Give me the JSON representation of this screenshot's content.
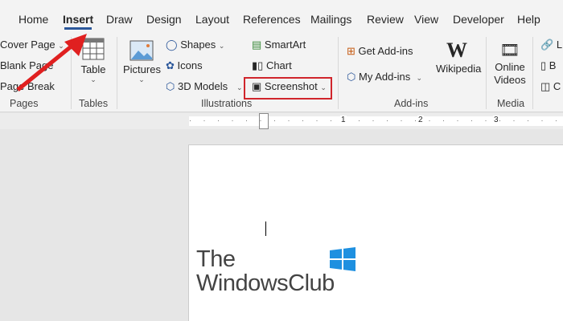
{
  "tabs": [
    "Home",
    "Insert",
    "Draw",
    "Design",
    "Layout",
    "References",
    "Mailings",
    "Review",
    "View",
    "Developer",
    "Help"
  ],
  "active_tab": "Insert",
  "pages": {
    "items": [
      "Cover Page",
      "Blank Page",
      "Page Break"
    ],
    "label": "Pages"
  },
  "tables": {
    "button": "Table",
    "label": "Tables"
  },
  "illustrations": {
    "pictures": "Pictures",
    "shapes": "Shapes",
    "icons": "Icons",
    "models": "3D Models",
    "smartart": "SmartArt",
    "chart": "Chart",
    "screenshot": "Screenshot",
    "label": "Illustrations"
  },
  "addins": {
    "get": "Get Add-ins",
    "my": "My Add-ins",
    "wikipedia": "Wikipedia",
    "label": "Add-ins"
  },
  "media": {
    "online_videos_1": "Online",
    "online_videos_2": "Videos",
    "label": "Media"
  },
  "links_partial": [
    "L",
    "B",
    "C"
  ],
  "ruler": [
    "1",
    "2",
    "3"
  ],
  "logo": {
    "line1": "The",
    "line2": "WindowsClub"
  },
  "colors": {
    "accent": "#2b579a",
    "highlight": "#d0252c"
  }
}
